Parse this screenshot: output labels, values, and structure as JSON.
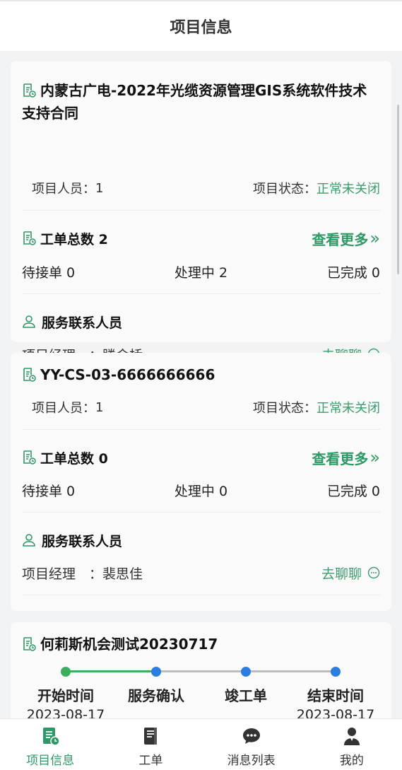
{
  "header": {
    "title": "项目信息"
  },
  "projects": [
    {
      "name": "内蒙古广电-2022年光缆资源管理GIS系统软件技术支持合同",
      "members_label": "项目人员：",
      "members_value": "1",
      "status_label": "项目状态：",
      "status_value": "正常未关闭",
      "orders_title": "工单总数 2",
      "more_label": "查看更多",
      "pending": "待接单 0",
      "processing": "处理中 2",
      "done": "已完成 0",
      "contacts_title": "服务联系人员",
      "manager_label": "项目经理　：",
      "manager_name": "滕金桥",
      "chat_label": "去聊聊"
    },
    {
      "name": "YY-CS-03-6666666666",
      "members_label": "项目人员：",
      "members_value": "1",
      "status_label": "项目状态：",
      "status_value": "正常未关闭",
      "orders_title": "工单总数 0",
      "more_label": "查看更多",
      "pending": "待接单 0",
      "processing": "处理中 0",
      "done": "已完成 0",
      "contacts_title": "服务联系人员",
      "manager_label": "项目经理　：",
      "manager_name": "裴思佳",
      "chat_label": "去聊聊"
    },
    {
      "name": "何莉斯机会测试20230717",
      "timeline": {
        "steps": [
          "开始时间",
          "服务确认",
          "竣工单",
          "结束时间"
        ],
        "start_date": "2023-08-17",
        "end_date": "2023-08-17",
        "completed_steps": 1
      }
    }
  ],
  "tabbar": {
    "items": [
      {
        "label": "项目信息",
        "icon": "project-info-icon",
        "active": true
      },
      {
        "label": "工单",
        "icon": "work-order-icon",
        "active": false
      },
      {
        "label": "消息列表",
        "icon": "message-list-icon",
        "active": false
      },
      {
        "label": "我的",
        "icon": "profile-icon",
        "active": false
      }
    ]
  },
  "colors": {
    "accent": "#2e9966",
    "step_done": "#3cae5c",
    "step_pending": "#2a7de1",
    "line_pending": "#bdbdbd"
  }
}
